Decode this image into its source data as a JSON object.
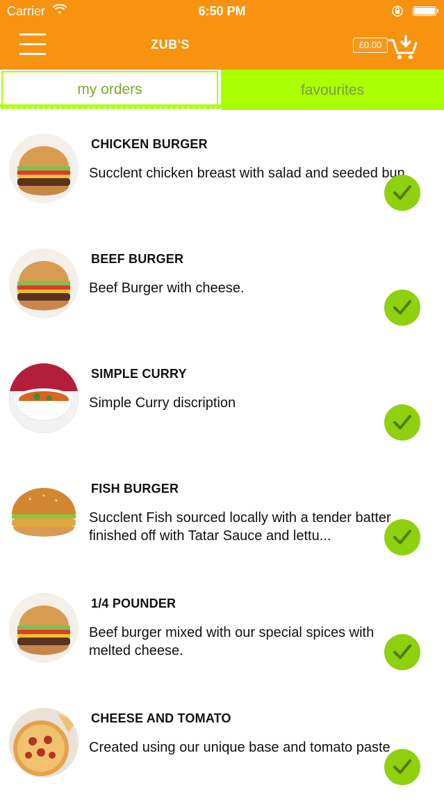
{
  "status_bar": {
    "carrier": "Carrier",
    "time": "6:50 PM"
  },
  "header": {
    "title": "ZUB'S",
    "cart_total": "£0.00"
  },
  "tabs": [
    {
      "label": "my orders",
      "active": true
    },
    {
      "label": "favourites",
      "active": false
    }
  ],
  "colors": {
    "header_orange": "#f7930e",
    "tab_green": "#aaff00",
    "check_green": "#8fd00f"
  },
  "items": [
    {
      "title": "CHICKEN BURGER",
      "description": "Succlent chicken breast with salad and seeded bun.",
      "image": "burger-image"
    },
    {
      "title": "BEEF BURGER",
      "description": "Beef Burger with cheese.",
      "image": "burger-image"
    },
    {
      "title": "SIMPLE CURRY",
      "description": "Simple Curry discription",
      "image": "curry-image"
    },
    {
      "title": "FISH BURGER",
      "description": "Succlent Fish sourced locally with a tender batter finished off with Tatar Sauce and lettu...",
      "image": "fish-burger-image"
    },
    {
      "title": "1/4 POUNDER",
      "description": "Beef burger mixed with our special spices with melted cheese.",
      "image": "burger-image"
    },
    {
      "title": "CHEESE AND TOMATO",
      "description": "Created using our unique base and tomato paste",
      "image": "pizza-image"
    }
  ]
}
